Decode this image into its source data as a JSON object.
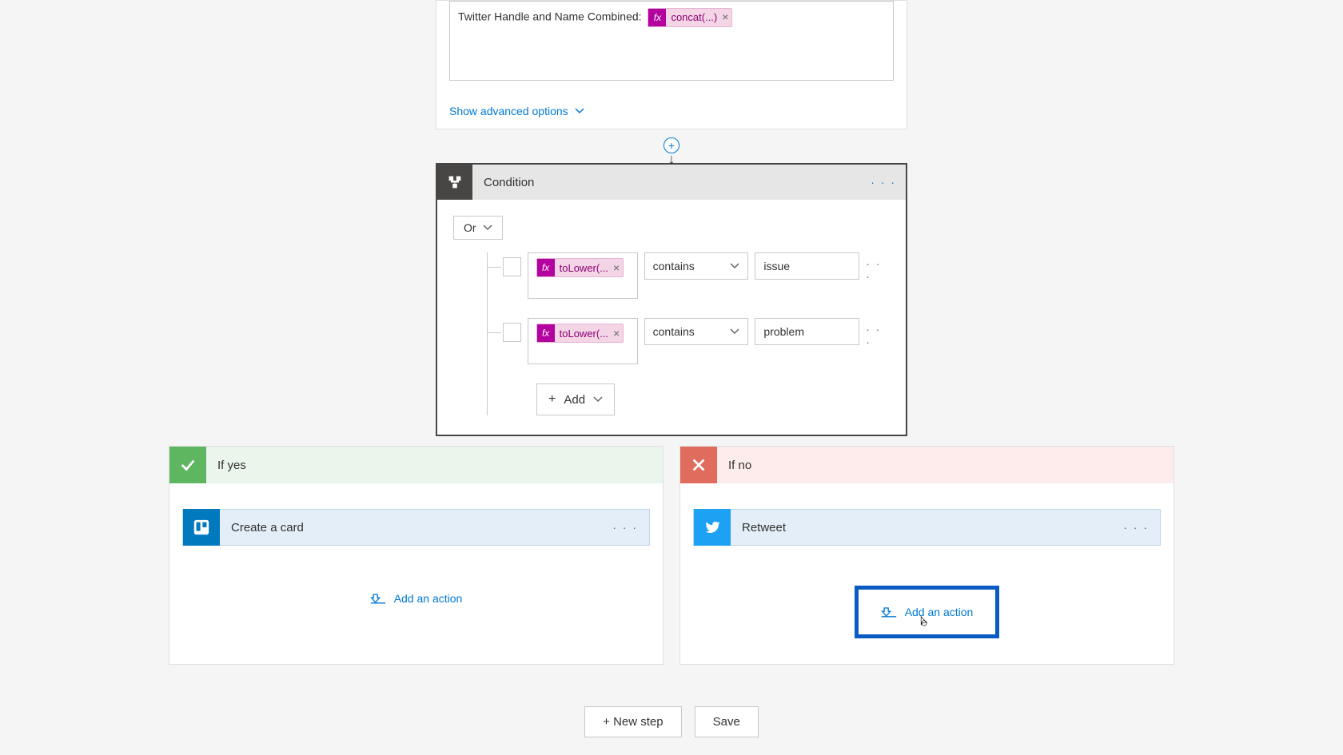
{
  "top_action": {
    "field_label": "Twitter Handle and Name Combined:",
    "token_label": "concat(...)",
    "advanced_options": "Show advanced options"
  },
  "condition": {
    "title": "Condition",
    "logic": "Or",
    "rows": [
      {
        "expr": "toLower(...",
        "operator": "contains",
        "value": "issue"
      },
      {
        "expr": "toLower(...",
        "operator": "contains",
        "value": "problem"
      }
    ],
    "add_label": "Add"
  },
  "branches": {
    "yes": {
      "title": "If yes",
      "action": {
        "title": "Create a card"
      },
      "add_action": "Add an action"
    },
    "no": {
      "title": "If no",
      "action": {
        "title": "Retweet"
      },
      "add_action": "Add an action"
    }
  },
  "footer": {
    "new_step": "+ New step",
    "save": "Save"
  }
}
